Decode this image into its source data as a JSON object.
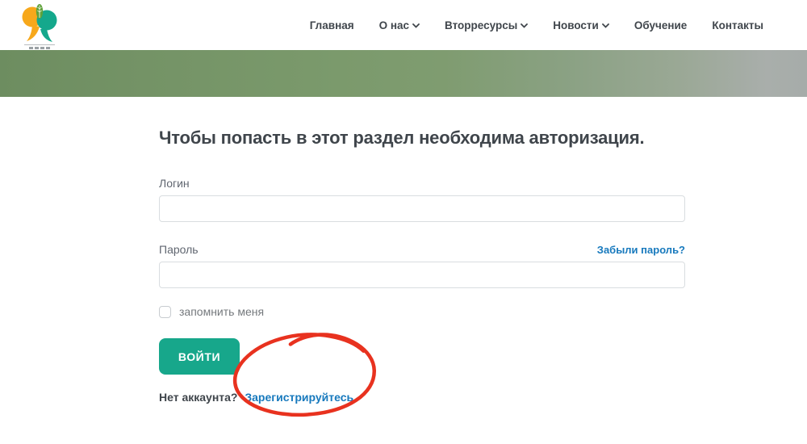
{
  "header": {
    "logo": {
      "name": "99-logo",
      "colors": {
        "yellow": "#f7a81b",
        "teal": "#14a88c",
        "leaf": "#5fa23b"
      }
    },
    "nav": [
      {
        "label": "Главная",
        "has_dropdown": false
      },
      {
        "label": "О нас",
        "has_dropdown": true
      },
      {
        "label": "Вторресурсы",
        "has_dropdown": true
      },
      {
        "label": "Новости",
        "has_dropdown": true
      },
      {
        "label": "Обучение",
        "has_dropdown": false
      },
      {
        "label": "Контакты",
        "has_dropdown": false
      }
    ],
    "icons": {
      "chevron_down": "⌄"
    }
  },
  "hero": {
    "type": "blurred-photo-banner",
    "dominant_colors": [
      "#6d8d60",
      "#7b9a6c",
      "#a9aeab"
    ]
  },
  "auth": {
    "heading": "Чтобы попасть в этот раздел необходима авторизация.",
    "login_label": "Логин",
    "login_value": "",
    "password_label": "Пароль",
    "password_value": "",
    "forgot_link": "Забыли пароль?",
    "remember_label": "запомнить меня",
    "remember_checked": false,
    "submit_label": "ВОЙТИ",
    "no_account_text": "Нет аккаунта?",
    "register_link": "Зарегистрируйтесь"
  },
  "annotation": {
    "type": "hand-drawn-ellipse",
    "target": "register_link",
    "color": "#e8321f"
  },
  "colors": {
    "accent_teal": "#17a78b",
    "link_blue": "#1779bd",
    "text_dark": "#3f454b",
    "label_gray": "#606670",
    "annotation_red": "#e8321f"
  }
}
